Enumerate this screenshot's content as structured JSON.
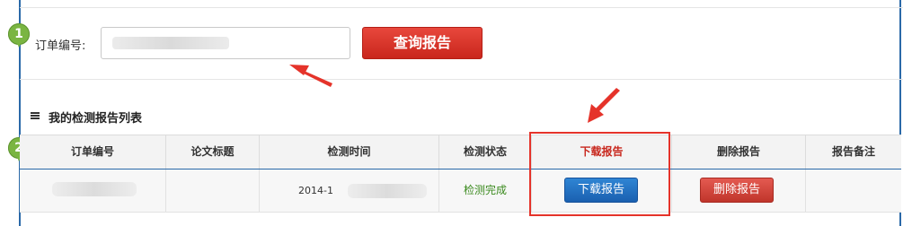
{
  "search": {
    "order_label": "订单编号:",
    "query_button": "查询报告"
  },
  "steps": [
    "1",
    "2"
  ],
  "list": {
    "title": "我的检测报告列表",
    "columns": [
      "订单编号",
      "论文标题",
      "检测时间",
      "检测状态",
      "下载报告",
      "删除报告",
      "报告备注"
    ],
    "rows": [
      {
        "time": "2014-1",
        "status": "检测完成",
        "download": "下载报告",
        "delete": "删除报告"
      }
    ]
  },
  "colors": {
    "accent_blue": "#2a69a8",
    "query_red": "#d9342a",
    "download_blue": "#1f6fc4",
    "status_green": "#3b8a1e",
    "step_green": "#7ab542"
  }
}
